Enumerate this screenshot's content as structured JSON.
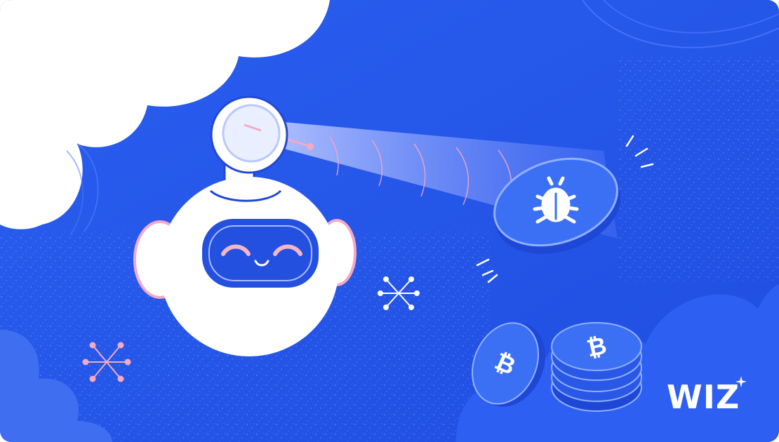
{
  "brand": {
    "logo_text": "WIZ",
    "logo_icon": "sparkle-icon",
    "logo_color": "#ffffff"
  },
  "illustration": {
    "subject": "robot-scanning-bug-coin",
    "icons": [
      "robot-icon",
      "magnifier-icon",
      "bug-icon",
      "bitcoin-icon",
      "sparkle-icon"
    ]
  },
  "colors": {
    "background": "#2456e8",
    "deep_blue": "#1b3fcf",
    "cloud": "#ffffff",
    "robot_body": "#ffffff",
    "robot_face": "#2450e0",
    "blush": "#f3b6c9",
    "beam": "#8fa6ff",
    "coin": "#3b6ef2",
    "coin_edge": "#2148d6",
    "accent_pink": "#f4a9c4"
  }
}
